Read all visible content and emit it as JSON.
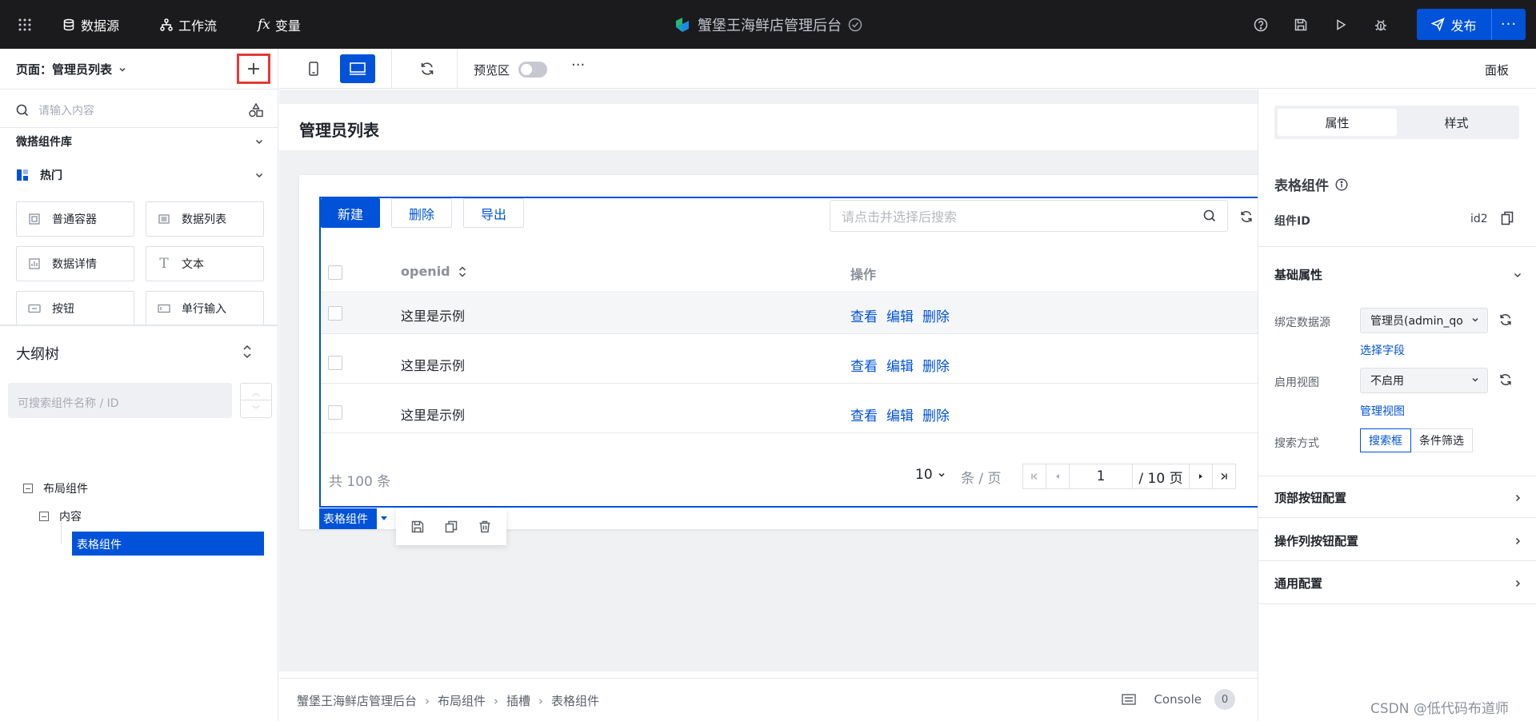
{
  "topbar": {
    "nav": [
      {
        "label": "数据源",
        "icon": "database-icon"
      },
      {
        "label": "工作流",
        "icon": "workflow-icon"
      },
      {
        "label": "变量",
        "icon": "fx-icon"
      }
    ],
    "app_title": "蟹堡王海鲜店管理后台",
    "publish_label": "发布",
    "more_label": "···"
  },
  "left_panel": {
    "page_label": "页面：管理员列表",
    "add_label": "+",
    "search_placeholder": "请输入内容",
    "library_title": "微搭组件库",
    "hot_title": "热门",
    "components": [
      {
        "label": "普通容器",
        "icon": "container-icon"
      },
      {
        "label": "数据列表",
        "icon": "data-list-icon"
      },
      {
        "label": "数据详情",
        "icon": "data-detail-icon"
      },
      {
        "label": "文本",
        "icon": "text-icon"
      },
      {
        "label": "按钮",
        "icon": "button-icon"
      },
      {
        "label": "单行输入",
        "icon": "single-input-icon"
      }
    ],
    "outline_title": "大纲树",
    "outline_search_placeholder": "可搜索组件名称 / ID",
    "tree": [
      {
        "label": "布局组件"
      },
      {
        "label": "内容"
      },
      {
        "label": "表格组件",
        "selected": true
      }
    ]
  },
  "toolbar": {
    "preview_label": "预览区",
    "preview_enabled": false,
    "more_label": "···",
    "panel_label": "面板"
  },
  "canvas": {
    "page_title": "管理员列表",
    "table": {
      "buttons": {
        "new": "新建",
        "delete": "删除",
        "export": "导出"
      },
      "search_placeholder": "请点击并选择后搜索",
      "columns": [
        "openid",
        "操作"
      ],
      "rows": [
        {
          "openid": "这里是示例",
          "actions": [
            "查看",
            "编辑",
            "删除"
          ]
        },
        {
          "openid": "这里是示例",
          "actions": [
            "查看",
            "编辑",
            "删除"
          ]
        },
        {
          "openid": "这里是示例",
          "actions": [
            "查看",
            "编辑",
            "删除"
          ]
        }
      ],
      "total_text": "共 100 条",
      "page_size": "10",
      "page_size_unit": "条 / 页",
      "current_page": "1",
      "total_pages_text": "/ 10 页"
    },
    "selected_tag": "表格组件"
  },
  "bottombar": {
    "breadcrumb": [
      "蟹堡王海鲜店管理后台",
      "布局组件",
      "插槽",
      "表格组件"
    ],
    "console_label": "Console",
    "console_count": "0"
  },
  "right_panel": {
    "tabs": [
      "属性",
      "样式"
    ],
    "active_tab": "属性",
    "component_title": "表格组件",
    "component_id_label": "组件ID",
    "component_id_value": "id2",
    "basic_props_title": "基础属性",
    "bind_source_label": "绑定数据源",
    "bind_source_value": "管理员(admin_qo",
    "select_fields_link": "选择字段",
    "view_label": "启用视图",
    "view_value": "不启用",
    "manage_view_link": "管理视图",
    "search_mode_label": "搜索方式",
    "search_mode_options": [
      "搜索框",
      "条件筛选"
    ],
    "search_mode_selected": "搜索框",
    "sections": [
      "顶部按钮配置",
      "操作列按钮配置",
      "通用配置"
    ]
  },
  "watermark": "CSDN @低代码布道师",
  "colors": {
    "accent": "#0052d9",
    "topbar_bg": "#1b1b1d",
    "highlight_border": "#e53935"
  }
}
